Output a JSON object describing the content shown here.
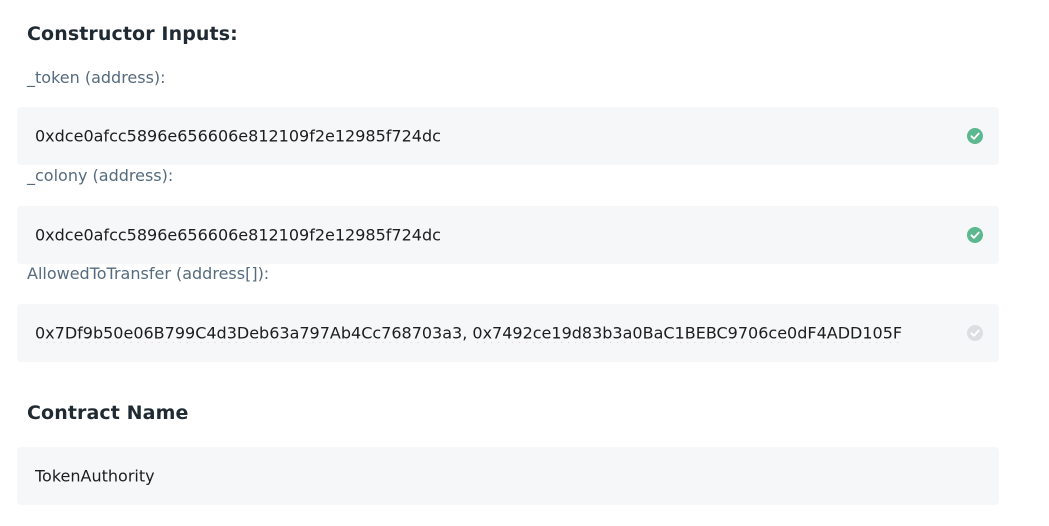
{
  "constructor": {
    "heading": "Constructor Inputs:",
    "fields": [
      {
        "label": "_token (address):",
        "value": "0xdce0afcc5896e656606e812109f2e12985f724dc",
        "valid": true
      },
      {
        "label": "_colony (address):",
        "value": "0xdce0afcc5896e656606e812109f2e12985f724dc",
        "valid": true
      },
      {
        "label": "AllowedToTransfer (address[]):",
        "value_part1": "0x7Df9b50e06B799C4d3Deb63a797Ab4Cc768703a3",
        "value_sep": ", ",
        "value_part2": "0x7492ce19d83b3a0BaC1BEBC9706ce0dF4ADD105F",
        "valid": false
      }
    ]
  },
  "contract": {
    "heading": "Contract Name",
    "value": "TokenAuthority"
  },
  "icons": {
    "valid_check": "check-circle-icon",
    "pending_check": "check-circle-icon"
  },
  "colors": {
    "valid": "#5cb88f",
    "pending": "#dcdfe2",
    "field_bg": "#f6f7f8",
    "spellcheck": "#d0342c"
  }
}
